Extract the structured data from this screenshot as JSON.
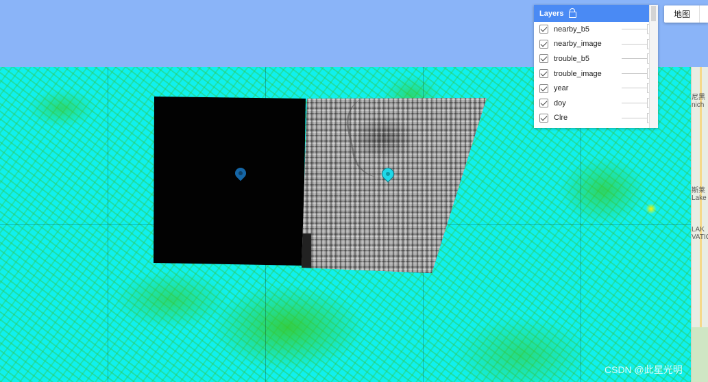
{
  "layers_panel": {
    "title": "Layers",
    "items": [
      {
        "label": "nearby_b5",
        "checked": true
      },
      {
        "label": "nearby_image",
        "checked": true
      },
      {
        "label": "trouble_b5",
        "checked": true
      },
      {
        "label": "trouble_image",
        "checked": true
      },
      {
        "label": "year",
        "checked": true
      },
      {
        "label": "doy",
        "checked": true
      },
      {
        "label": "Clre",
        "checked": true
      }
    ]
  },
  "map_type_button": {
    "label": "地图"
  },
  "map_labels": {
    "label1": "尼黑",
    "label2": "nich",
    "label3": "斯莱",
    "label4": "Lake",
    "label5": "LAK",
    "label6": "VATIO"
  },
  "watermark": "CSDN @此星光明",
  "colors": {
    "water": "#10f0ee",
    "vegetation": "#38c828",
    "highlight": "#f5f50a",
    "panel_header": "#4a8af4"
  }
}
